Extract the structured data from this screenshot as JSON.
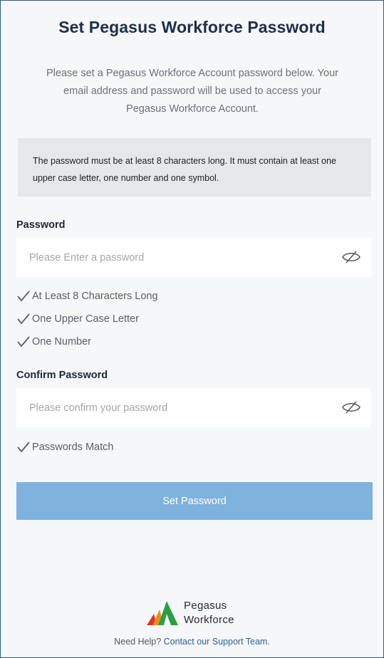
{
  "header": {
    "title": "Set Pegasus Workforce Password",
    "intro": "Please set a Pegasus Workforce Account password below. Your email address and password will be used to access your Pegasus Workforce Account."
  },
  "rules": {
    "text": "The password must be at least 8 characters long. It must contain at least one upper case letter, one number and one symbol."
  },
  "password": {
    "label": "Password",
    "value": "",
    "placeholder": "Please Enter a password",
    "toggle_icon": "eye-slash-icon",
    "checks": [
      {
        "icon": "checkmark-icon",
        "label": "At Least 8 Characters Long"
      },
      {
        "icon": "checkmark-icon",
        "label": "One Upper Case Letter"
      },
      {
        "icon": "checkmark-icon",
        "label": "One Number"
      }
    ]
  },
  "confirm": {
    "label": "Confirm Password",
    "value": "",
    "placeholder": "Please confirm your password",
    "toggle_icon": "eye-slash-icon",
    "checks": [
      {
        "icon": "checkmark-icon",
        "label": "Passwords Match"
      }
    ]
  },
  "actions": {
    "submit_label": "Set Password"
  },
  "footer": {
    "brand_line1": "Pegasus",
    "brand_line2": "Workforce",
    "help_text": "Need Help?",
    "help_link": "Contact our Support Team."
  },
  "colors": {
    "button": "#7fb2dc",
    "title": "#1e2f4a",
    "link": "#2e5f93",
    "rules_bg": "#e6e7e9",
    "logo_green": "#2e9e46",
    "logo_orange": "#f08a1c",
    "logo_red": "#d9352a"
  }
}
